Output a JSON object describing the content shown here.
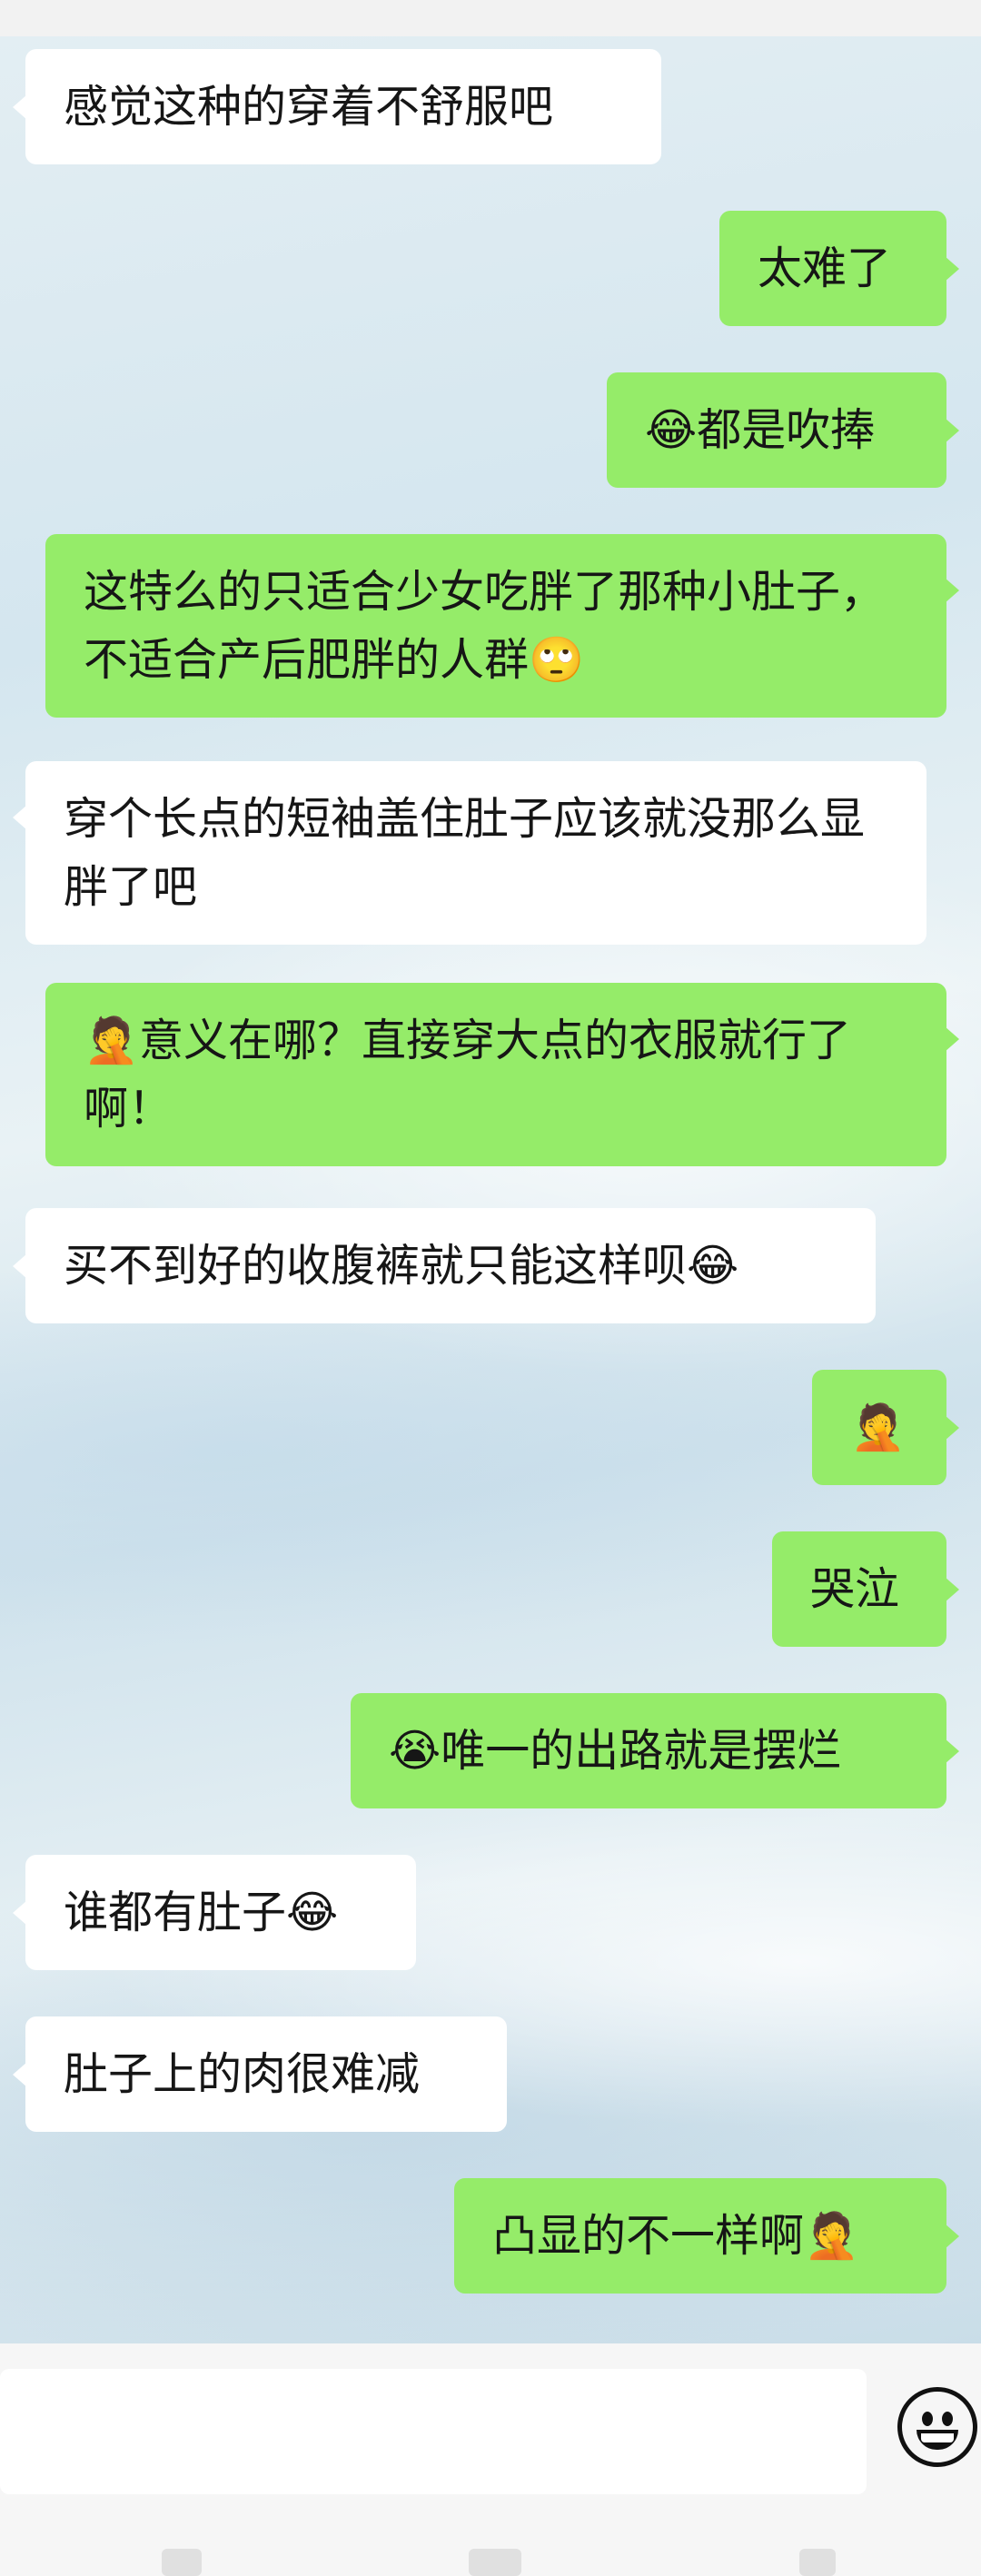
{
  "messages": [
    {
      "side": "in",
      "text": "感觉这种的穿着不舒服吧"
    },
    {
      "side": "out",
      "text": "太难了"
    },
    {
      "side": "out",
      "text": "😂都是吹捧"
    },
    {
      "side": "out",
      "text": "这特么的只适合少女吃胖了那种小肚子，不适合产后肥胖的人群🙄"
    },
    {
      "side": "in",
      "text": "穿个长点的短袖盖住肚子应该就没那么显胖了吧"
    },
    {
      "side": "out",
      "text": "🤦意义在哪？直接穿大点的衣服就行了啊！"
    },
    {
      "side": "in",
      "text": "买不到好的收腹裤就只能这样呗😂"
    },
    {
      "side": "out",
      "text": "🤦"
    },
    {
      "side": "out",
      "text": "哭泣"
    },
    {
      "side": "out",
      "text": "😭唯一的出路就是摆烂"
    },
    {
      "side": "in",
      "text": "谁都有肚子😂"
    },
    {
      "side": "in",
      "text": "肚子上的肉很难减"
    },
    {
      "side": "out",
      "text": "凸显的不一样啊🤦"
    }
  ],
  "input": {
    "value": "",
    "placeholder": ""
  },
  "icons": {
    "emoji_button": "smiley-face-icon"
  },
  "colors": {
    "outgoing_bubble": "#95ec69",
    "incoming_bubble": "#ffffff",
    "input_bar_bg": "#f6f6f6"
  }
}
